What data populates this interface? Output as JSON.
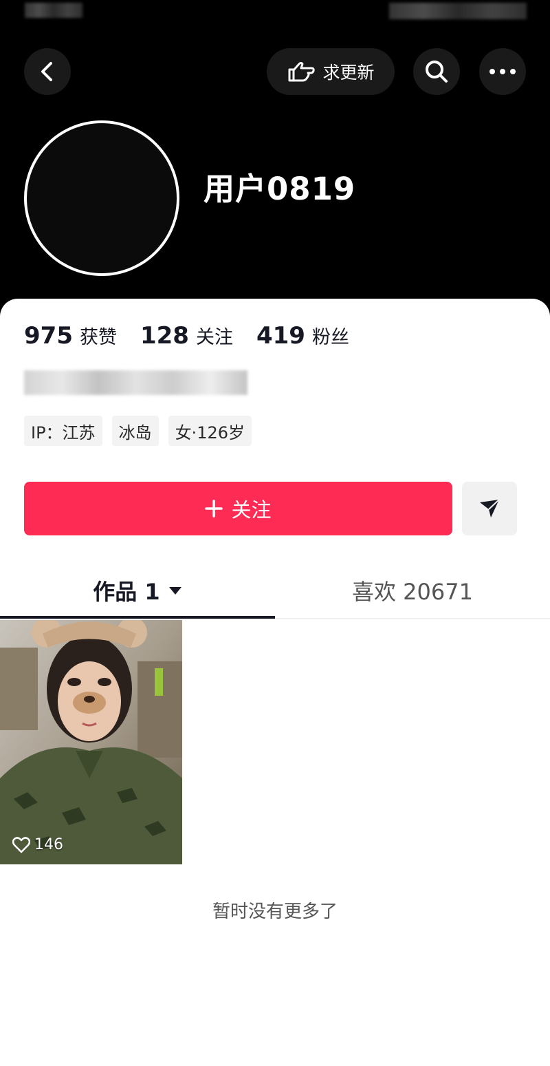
{
  "header": {
    "back_icon": "chevron-left-icon",
    "request_update_label": "求更新",
    "request_update_icon": "pointing-hand-icon",
    "search_icon": "search-icon",
    "more_icon": "more-dots-icon"
  },
  "profile": {
    "username": "用户0819",
    "stats": [
      {
        "value": "975",
        "label": "获赞"
      },
      {
        "value": "128",
        "label": "关注"
      },
      {
        "value": "419",
        "label": "粉丝"
      }
    ],
    "tags": [
      "IP：江苏",
      "冰岛",
      "女·126岁"
    ]
  },
  "actions": {
    "follow_label": "关注",
    "share_icon": "send-icon",
    "accent_color": "#fe2c55"
  },
  "tabs": {
    "works_label": "作品 1",
    "likes_label": "喜欢 20671"
  },
  "video": {
    "likes": "146",
    "like_icon": "heart-icon"
  },
  "footer": {
    "end_text": "暂时没有更多了"
  }
}
